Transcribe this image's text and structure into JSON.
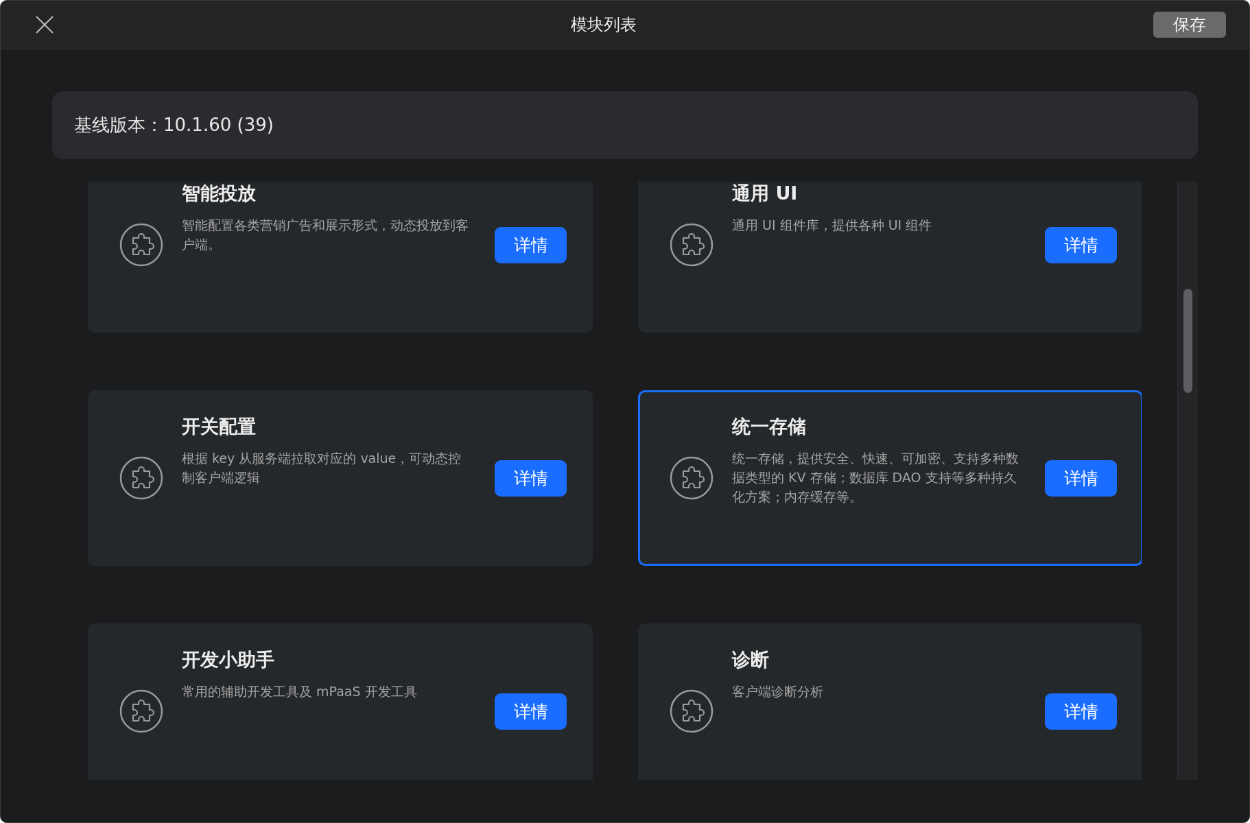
{
  "window": {
    "title": "模块列表",
    "save_button": "保存"
  },
  "version": {
    "text": "基线版本：10.1.60 (39)"
  },
  "modules": [
    {
      "title": "智能投放",
      "description": "智能配置各类营销广告和展示形式，动态投放到客户端。",
      "button": "详情",
      "selected": false
    },
    {
      "title": "通用 UI",
      "description": "通用 UI 组件库，提供各种 UI 组件",
      "button": "详情",
      "selected": false
    },
    {
      "title": "开关配置",
      "description": "根据 key 从服务端拉取对应的 value，可动态控制客户端逻辑",
      "button": "详情",
      "selected": false
    },
    {
      "title": "统一存储",
      "description": "统一存储，提供安全、快速、可加密、支持多种数据类型的 KV 存储；数据库 DAO 支持等多种持久化方案；内存缓存等。",
      "button": "详情",
      "selected": true
    },
    {
      "title": "开发小助手",
      "description": "常用的辅助开发工具及 mPaaS 开发工具",
      "button": "详情",
      "selected": false
    },
    {
      "title": "诊断",
      "description": "客户端诊断分析",
      "button": "详情",
      "selected": false
    }
  ]
}
